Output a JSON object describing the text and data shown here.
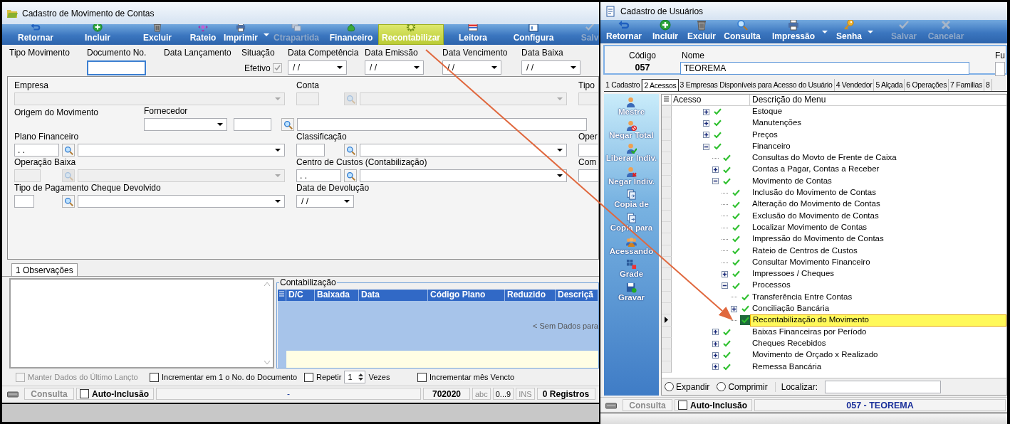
{
  "movement_window": {
    "title": "Cadastro de Movimento de Contas",
    "toolbar": [
      {
        "label": "Retornar",
        "disabled": false,
        "highlighted": false,
        "dropdown": false
      },
      {
        "label": "Incluir",
        "disabled": false,
        "highlighted": false,
        "dropdown": false
      },
      {
        "label": "Excluir",
        "disabled": false,
        "highlighted": false,
        "dropdown": false
      },
      {
        "label": "Rateio",
        "disabled": false,
        "highlighted": false,
        "dropdown": false
      },
      {
        "label": "Imprimir",
        "disabled": false,
        "highlighted": false,
        "dropdown": true
      },
      {
        "label": "Ctrapartida",
        "disabled": true,
        "highlighted": false,
        "dropdown": false
      },
      {
        "label": "Financeiro",
        "disabled": false,
        "highlighted": false,
        "dropdown": false
      },
      {
        "label": "Recontabilizar",
        "disabled": false,
        "highlighted": true,
        "dropdown": false
      },
      {
        "label": "Leitora",
        "disabled": false,
        "highlighted": false,
        "dropdown": false
      },
      {
        "label": "Configura",
        "disabled": false,
        "highlighted": false,
        "dropdown": false
      },
      {
        "label": "Salv",
        "disabled": true,
        "highlighted": false,
        "dropdown": false
      }
    ],
    "header_fields": [
      {
        "label": "Tipo Movimento",
        "kind": "label"
      },
      {
        "label": "Documento No.",
        "kind": "text",
        "focused": true
      },
      {
        "label": "Data Lançamento",
        "kind": "label"
      },
      {
        "label": "Situação",
        "kind": "check",
        "text": "Efetivo",
        "checked": true,
        "disabled": true
      },
      {
        "label": "Data Competência",
        "kind": "date",
        "value": "/ /"
      },
      {
        "label": "Data Emissão",
        "kind": "date",
        "value": "/ /"
      },
      {
        "label": "Data Vencimento",
        "kind": "date",
        "value": "/ /"
      },
      {
        "label": "Data Baixa",
        "kind": "date",
        "value": "/ /"
      }
    ],
    "form_rows": [
      [
        {
          "label": "Empresa",
          "controls": [
            {
              "kind": "combo",
              "disabled": true
            }
          ]
        },
        {
          "label": "Conta",
          "controls": [
            {
              "kind": "box",
              "disabled": true
            },
            {
              "kind": "search",
              "disabled": true
            },
            {
              "kind": "combo",
              "disabled": true
            }
          ]
        },
        {
          "label": "Tipo",
          "controls": [
            {
              "kind": "box",
              "disabled": true
            }
          ]
        }
      ],
      [
        {
          "label": "Origem do Movimento"
        },
        {
          "label": "Fornecedor",
          "controls": [
            {
              "kind": "combo",
              "disabled": false
            },
            {
              "kind": "box",
              "disabled": false
            },
            {
              "kind": "search",
              "disabled": false
            },
            {
              "kind": "box",
              "disabled": false
            }
          ]
        }
      ],
      [
        {
          "label": "Plano Financeiro",
          "controls": [
            {
              "kind": "box",
              "value": ". .",
              "disabled": false
            },
            {
              "kind": "search",
              "disabled": false
            },
            {
              "kind": "combo",
              "disabled": false
            }
          ]
        },
        {
          "label": "Classificação",
          "controls": [
            {
              "kind": "box",
              "disabled": false
            },
            {
              "kind": "search",
              "disabled": false
            },
            {
              "kind": "combo",
              "disabled": false
            }
          ]
        },
        {
          "label": "Oper",
          "controls": [
            {
              "kind": "box",
              "disabled": false
            }
          ]
        }
      ],
      [
        {
          "label": "Operação Baixa",
          "controls": [
            {
              "kind": "box",
              "disabled": true
            },
            {
              "kind": "search",
              "disabled": true
            },
            {
              "kind": "combo",
              "disabled": true
            }
          ]
        },
        {
          "label": "Centro de Custos (Contabilização)",
          "controls": [
            {
              "kind": "box",
              "value": ". .",
              "disabled": false
            },
            {
              "kind": "search",
              "disabled": false
            },
            {
              "kind": "combo",
              "disabled": false
            }
          ]
        },
        {
          "label": "Com",
          "controls": [
            {
              "kind": "box",
              "disabled": false
            }
          ]
        }
      ],
      [
        {
          "label": "Tipo de Pagamento Cheque Devolvido",
          "controls": [
            {
              "kind": "box",
              "disabled": false
            },
            {
              "kind": "search",
              "disabled": false
            },
            {
              "kind": "combo",
              "disabled": false
            }
          ]
        },
        {
          "label": "Data de Devolução",
          "controls": [
            {
              "kind": "date",
              "value": "/ /",
              "disabled": false
            }
          ]
        }
      ]
    ],
    "tabs": [
      {
        "label": "1 Observações",
        "selected": true
      }
    ],
    "accounting": {
      "title": "Contabilização",
      "columns": [
        "D/C",
        "Baixada",
        "Data",
        "Código Plano",
        "Reduzido",
        "Descriçã"
      ],
      "empty_text": "< Sem Dados para"
    },
    "options": [
      {
        "kind": "check",
        "label": "Manter Dados do Último Lançto",
        "checked": false,
        "disabled": true
      },
      {
        "kind": "check",
        "label": "Incrementar em 1 o No. do Documento",
        "checked": false,
        "disabled": false
      },
      {
        "kind": "repeat",
        "label": "Repetir",
        "checked": false,
        "disabled": false,
        "value": "1",
        "suffix": "Vezes"
      },
      {
        "kind": "check",
        "label": "Incrementar mês Vencto",
        "checked": false,
        "disabled": false
      }
    ],
    "status_bar": {
      "mode": "Consulta",
      "auto_include": {
        "label": "Auto-Inclusão",
        "checked": false
      },
      "message": "-",
      "code": "702020",
      "indicators": [
        {
          "label": "abc",
          "active": false
        },
        {
          "label": "0...9",
          "active": true
        },
        {
          "label": "INS",
          "active": false
        }
      ],
      "records": "0 Registros"
    }
  },
  "users_window": {
    "title": "Cadastro de Usuários",
    "toolbar": [
      {
        "label": "Retornar",
        "disabled": false,
        "dropdown": false
      },
      {
        "label": "Incluir",
        "disabled": false,
        "dropdown": false
      },
      {
        "label": "Excluir",
        "disabled": false,
        "dropdown": false
      },
      {
        "label": "Consulta",
        "disabled": false,
        "dropdown": false
      },
      {
        "label": "Impressão",
        "disabled": false,
        "dropdown": true
      },
      {
        "label": "Senha",
        "disabled": false,
        "dropdown": true
      },
      {
        "label": "Salvar",
        "disabled": true,
        "dropdown": false
      },
      {
        "label": "Cancelar",
        "disabled": true,
        "dropdown": false
      }
    ],
    "code_label": "Código",
    "code": "057",
    "name_label": "Nome",
    "name": "TEOREMA",
    "extra_label": "Fu",
    "tabs": [
      {
        "label": "1 Cadastro",
        "selected": false
      },
      {
        "label": "2 Acessos",
        "selected": true
      },
      {
        "label": "3 Empresas Disponíveis para Acesso do Usuário",
        "selected": false
      },
      {
        "label": "4 Vendedor",
        "selected": false
      },
      {
        "label": "5 Alçada",
        "selected": false
      },
      {
        "label": "6 Operações",
        "selected": false
      },
      {
        "label": "7 Familias",
        "selected": false
      },
      {
        "label": "8",
        "selected": false
      }
    ],
    "side_actions": [
      "Mestre",
      "Negar Total",
      "Liberar Indiv.",
      "Negar Indiv.",
      "Copia de",
      "Copia para",
      "Acessando",
      "Grade",
      "Gravar"
    ],
    "tree": {
      "columns": [
        "Acesso",
        "Descrição do Menu"
      ],
      "nodes": [
        {
          "label": "Estoque",
          "checked": true,
          "expandable": true,
          "expanded": false,
          "selected": false
        },
        {
          "label": "Manutenções",
          "checked": true,
          "expandable": true,
          "expanded": false,
          "selected": false
        },
        {
          "label": "Preços",
          "checked": true,
          "expandable": true,
          "expanded": false,
          "selected": false
        },
        {
          "label": "Financeiro",
          "checked": true,
          "expandable": true,
          "expanded": true,
          "selected": false,
          "children": [
            {
              "label": "Consultas do Movto de Frente de Caixa",
              "checked": true,
              "expandable": false,
              "selected": false
            },
            {
              "label": "Contas a Pagar, Contas a Receber",
              "checked": true,
              "expandable": true,
              "expanded": false,
              "selected": false
            },
            {
              "label": "Movimento de Contas",
              "checked": true,
              "expandable": true,
              "expanded": true,
              "selected": false,
              "children": [
                {
                  "label": "Inclusão do Movimento de Contas",
                  "checked": true,
                  "expandable": false,
                  "selected": false
                },
                {
                  "label": "Alteração do Movimento de Contas",
                  "checked": true,
                  "expandable": false,
                  "selected": false
                },
                {
                  "label": "Exclusão do Movimento de Contas",
                  "checked": true,
                  "expandable": false,
                  "selected": false
                },
                {
                  "label": "Localizar Movimento de Contas",
                  "checked": true,
                  "expandable": false,
                  "selected": false
                },
                {
                  "label": "Impressão do Movimento de Contas",
                  "checked": true,
                  "expandable": false,
                  "selected": false
                },
                {
                  "label": "Rateio de Centros de Custos",
                  "checked": true,
                  "expandable": false,
                  "selected": false
                },
                {
                  "label": "Consultar Movimento Financeiro",
                  "checked": true,
                  "expandable": false,
                  "selected": false
                },
                {
                  "label": "Impressoes / Cheques",
                  "checked": true,
                  "expandable": true,
                  "expanded": false,
                  "selected": false
                },
                {
                  "label": "Processos",
                  "checked": true,
                  "expandable": true,
                  "expanded": true,
                  "selected": false,
                  "children": [
                    {
                      "label": "Transferência Entre Contas",
                      "checked": true,
                      "expandable": false,
                      "selected": false
                    },
                    {
                      "label": "Conciliação Bancária",
                      "checked": true,
                      "expandable": true,
                      "expanded": false,
                      "selected": false
                    },
                    {
                      "label": "Recontabilização do Movimento",
                      "checked": true,
                      "expandable": false,
                      "selected": true
                    }
                  ]
                }
              ]
            },
            {
              "label": "Baixas Financeiras por Período",
              "checked": true,
              "expandable": true,
              "expanded": false,
              "selected": false
            },
            {
              "label": "Cheques Recebidos",
              "checked": true,
              "expandable": true,
              "expanded": false,
              "selected": false
            },
            {
              "label": "Movimento de Orçado x Realizado",
              "checked": true,
              "expandable": true,
              "expanded": false,
              "selected": false
            },
            {
              "label": "Remessa Bancária",
              "checked": true,
              "expandable": true,
              "expanded": false,
              "selected": false
            }
          ]
        }
      ]
    },
    "expand_options": [
      {
        "label": "Expandir",
        "selected": false
      },
      {
        "label": "Comprimir",
        "selected": false
      }
    ],
    "search_label": "Localizar:",
    "status_bar": {
      "mode": "Consulta",
      "auto_include": {
        "label": "Auto-Inclusão",
        "checked": false
      },
      "user": "057 - TEOREMA"
    }
  },
  "annotations": [
    {
      "kind": "arrow"
    }
  ]
}
